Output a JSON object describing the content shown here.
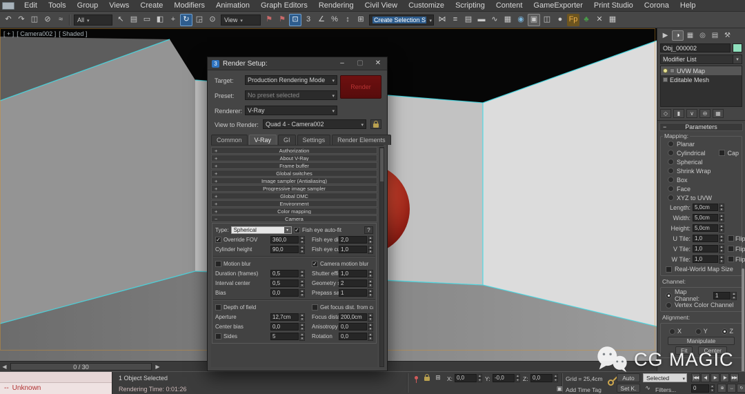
{
  "colors": {
    "accent_cyan": "#45dde8",
    "selection_blue": "#2e5d8e",
    "render_button_red": "#6e1010",
    "object_color_swatch": "#8fe0bd",
    "listener_pink": "#efe2e2",
    "sphere_red": "#c62a1e"
  },
  "app": {
    "logo": "3",
    "menu": [
      "Edit",
      "Tools",
      "Group",
      "Views",
      "Create",
      "Modifiers",
      "Animation",
      "Graph Editors",
      "Rendering",
      "Civil View",
      "Customize",
      "Scripting",
      "Content",
      "GameExporter",
      "Print Studio",
      "Corona",
      "Help"
    ]
  },
  "toolbar": {
    "seg1": [
      {
        "name": "undo-icon",
        "g": "↶"
      },
      {
        "name": "redo-icon",
        "g": "↷"
      },
      {
        "name": "select-and-link-icon",
        "g": "◫"
      },
      {
        "name": "unlink-selection-icon",
        "g": "⊘"
      },
      {
        "name": "bind-to-space-warp-icon",
        "g": "≈"
      }
    ],
    "filter_value": "All",
    "seg2": [
      {
        "name": "select-object-icon",
        "g": "↖"
      },
      {
        "name": "select-by-name-icon",
        "g": "▤"
      },
      {
        "name": "rectangular-selection-icon",
        "g": "▭"
      },
      {
        "name": "window-crossing-icon",
        "g": "◧"
      },
      {
        "name": "select-and-move-icon",
        "g": "+"
      },
      {
        "name": "select-and-rotate-icon",
        "g": "↻",
        "active": true
      },
      {
        "name": "select-and-scale-icon",
        "g": "◲"
      },
      {
        "name": "use-pivot-center-icon",
        "g": "⊙"
      }
    ],
    "coord_value": "View",
    "seg3": [
      {
        "name": "mirror-flag-icon",
        "g": "⚑",
        "c": "#c96a6a"
      },
      {
        "name": "bookmark-flag-icon",
        "g": "⚑",
        "c": "#c96a6a"
      },
      {
        "name": "snaps-toggle-icon",
        "g": "⊡",
        "active": true
      },
      {
        "name": "snaps-3d-icon",
        "g": "3"
      },
      {
        "name": "angle-snap-icon",
        "g": "∠"
      },
      {
        "name": "percent-snap-icon",
        "g": "%"
      },
      {
        "name": "spinner-snap-icon",
        "g": "↕"
      },
      {
        "name": "keyboard-override-icon",
        "g": "⊞"
      }
    ],
    "named_sel_value": "Create Selection S",
    "seg4": [
      {
        "name": "mirror-icon",
        "g": "⋈"
      },
      {
        "name": "align-icon",
        "g": "≡"
      },
      {
        "name": "layer-manager-icon",
        "g": "▤"
      },
      {
        "name": "ribbon-toggle-icon",
        "g": "▬"
      },
      {
        "name": "curve-editor-icon",
        "g": "∿"
      },
      {
        "name": "schematic-view-icon",
        "g": "▦"
      },
      {
        "name": "material-editor-icon",
        "g": "◉",
        "c": "#7ab3d9"
      },
      {
        "name": "render-setup-icon",
        "g": "▣",
        "hl": true
      },
      {
        "name": "rendered-frame-icon",
        "g": "◫"
      },
      {
        "name": "render-production-icon",
        "g": "●"
      },
      {
        "name": "fp-plugin-icon",
        "g": "Fp",
        "c": "#f0b14a",
        "box": "#6d551f"
      },
      {
        "name": "forest-pack-icon",
        "g": "♣",
        "c": "#4a9e4a"
      },
      {
        "name": "plugin-tools-icon",
        "g": "✕"
      },
      {
        "name": "grid-plugin-icon",
        "g": "▦"
      }
    ]
  },
  "viewport": {
    "label_plus": "[ + ]",
    "label_camera": "[ Camera002 ]",
    "label_shading": "[ Shaded ]",
    "time_slider_value": "0 / 30"
  },
  "dialog": {
    "title": "Render Setup:",
    "target_label": "Target:",
    "target_value": "Production Rendering Mode",
    "preset_label": "Preset:",
    "preset_value": "No preset selected",
    "renderer_label": "Renderer:",
    "renderer_value": "V-Ray",
    "view_label": "View to Render:",
    "view_value": "Quad 4 - Camera002",
    "render_button": "Render",
    "tabs": [
      {
        "name": "tab-common",
        "label": "Common"
      },
      {
        "name": "tab-vray",
        "label": "V-Ray",
        "active": true
      },
      {
        "name": "tab-gi",
        "label": "GI"
      },
      {
        "name": "tab-settings",
        "label": "Settings"
      },
      {
        "name": "tab-render-elements",
        "label": "Render Elements"
      }
    ],
    "rollouts": [
      "Authorization",
      "About V-Ray",
      "Frame buffer",
      "Global switches",
      "Image sampler (Antialiasing)",
      "Progressive image sampler",
      "Global DMC",
      "Environment",
      "Color mapping"
    ],
    "camera": {
      "title": "Camera",
      "type_label": "Type:",
      "type_value": "Spherical",
      "fish_eye_auto_fit": "Fish eye auto-fit",
      "help": "?",
      "override_fov": "Override FOV",
      "override_fov_value": "360,0",
      "fish_eye_dist": "Fish eye dist",
      "fish_eye_dist_value": "2,0",
      "cylinder_height": "Cylinder height",
      "cylinder_height_value": "90,0",
      "fish_eye_curve": "Fish eye curve",
      "fish_eye_curve_value": "1,0",
      "motion_blur": "Motion blur",
      "camera_motion_blur": "Camera motion blur",
      "duration": "Duration (frames)",
      "duration_value": "0,5",
      "shutter_efficiency": "Shutter efficiency",
      "shutter_efficiency_value": "1,0",
      "interval_center": "Interval center",
      "interval_center_value": "0,5",
      "geometry_samples": "Geometry samples",
      "geometry_samples_value": "2",
      "bias": "Bias",
      "bias_value": "0,0",
      "prepass_samples": "Prepass samples",
      "prepass_samples_value": "1",
      "depth_of_field": "Depth of field",
      "get_focus": "Get focus dist. from camera",
      "aperture": "Aperture",
      "aperture_value": "12,7cm",
      "focus_distance": "Focus distance",
      "focus_distance_value": "200,0cm",
      "center_bias": "Center bias",
      "center_bias_value": "0,0",
      "anisotropy": "Anisotropy",
      "anisotropy_value": "0,0",
      "sides": "Sides",
      "sides_value": "5",
      "rotation": "Rotation",
      "rotation_value": "0,0"
    }
  },
  "panel": {
    "tabs": [
      {
        "name": "tab-create",
        "g": "▶"
      },
      {
        "name": "tab-modify",
        "g": "◑",
        "active": true
      },
      {
        "name": "tab-hierarchy",
        "g": "▦"
      },
      {
        "name": "tab-motion",
        "g": "◎"
      },
      {
        "name": "tab-display",
        "g": "▤"
      },
      {
        "name": "tab-utilities",
        "g": "⚒"
      }
    ],
    "object_name": "Obj_000002",
    "modifier_list_label": "Modifier List",
    "stack": [
      {
        "name": "stack-item-uvw-map",
        "label": "UVW Map",
        "bulb": true,
        "sel": true
      },
      {
        "name": "stack-item-editable-mesh",
        "label": "Editable Mesh"
      }
    ],
    "stack_tools": [
      {
        "name": "pin-stack-icon",
        "g": "◇"
      },
      {
        "name": "show-end-result-icon",
        "g": "▮"
      },
      {
        "name": "make-unique-icon",
        "g": "∨"
      },
      {
        "name": "remove-modifier-icon",
        "g": "⊖"
      },
      {
        "name": "configure-modifier-sets-icon",
        "g": "▦"
      }
    ],
    "parameters_title": "Parameters",
    "mapping_label": "Mapping:",
    "mapping_options": [
      {
        "name": "radio-planar",
        "label": "Planar"
      },
      {
        "name": "radio-cylindrical",
        "label": "Cylindrical",
        "extra": "Cap"
      },
      {
        "name": "radio-spherical",
        "label": "Spherical"
      },
      {
        "name": "radio-shrink-wrap",
        "label": "Shrink Wrap"
      },
      {
        "name": "radio-box",
        "label": "Box",
        "on": true
      },
      {
        "name": "radio-face",
        "label": "Face"
      },
      {
        "name": "radio-xyz-to-uvw",
        "label": "XYZ to UVW"
      }
    ],
    "length_label": "Length:",
    "length_value": "5,0cm",
    "width_label": "Width:",
    "width_value": "5,0cm",
    "height_label": "Height:",
    "height_value": "5,0cm",
    "u_tile_label": "U Tile:",
    "u_tile_value": "1,0",
    "v_tile_label": "V Tile:",
    "v_tile_value": "1,0",
    "w_tile_label": "W Tile:",
    "w_tile_value": "1,0",
    "flip_label": "Flip",
    "real_world": "Real-World Map Size",
    "channel_label": "Channel:",
    "map_channel_label": "Map Channel:",
    "map_channel_value": "1",
    "vertex_color_label": "Vertex Color Channel",
    "alignment_label": "Alignment:",
    "align_x": "X",
    "align_y": "Y",
    "align_z": "Z",
    "manipulate_label": "Manipulate",
    "fit_label": "Fit",
    "center_label": "Center"
  },
  "status": {
    "listener_prefix": "--",
    "listener_text": "Unknown",
    "selection_message": "1 Object Selected",
    "prompt_message": "Rendering Time: 0:01:26",
    "x_label": "X:",
    "x_value": "0,0",
    "y_label": "Y:",
    "y_value": "-0,0",
    "z_label": "Z:",
    "z_value": "0,0",
    "grid_label": "Grid = 25,4cm",
    "add_time_tag": "Add Time Tag",
    "auto_key_label": "Auto",
    "set_key_label": "Set K.",
    "selected_dropdown_value": "Selected",
    "filters_label": "Filters...",
    "time_value": "0",
    "playback": [
      {
        "name": "go-to-start-button",
        "g": "|◀◀"
      },
      {
        "name": "previous-frame-button",
        "g": "◀|"
      },
      {
        "name": "play-button",
        "g": "▶"
      },
      {
        "name": "next-frame-button",
        "g": "|▶"
      },
      {
        "name": "go-to-end-button",
        "g": "▶▶|"
      }
    ],
    "nav": [
      {
        "name": "zoom-extents-icon",
        "g": "⊕"
      },
      {
        "name": "pan-icon",
        "g": "↔"
      },
      {
        "name": "orbit-icon",
        "g": "↻"
      },
      {
        "name": "maximize-viewport-icon",
        "g": "◱"
      }
    ]
  },
  "watermark": {
    "text": "CG MAGIC"
  }
}
